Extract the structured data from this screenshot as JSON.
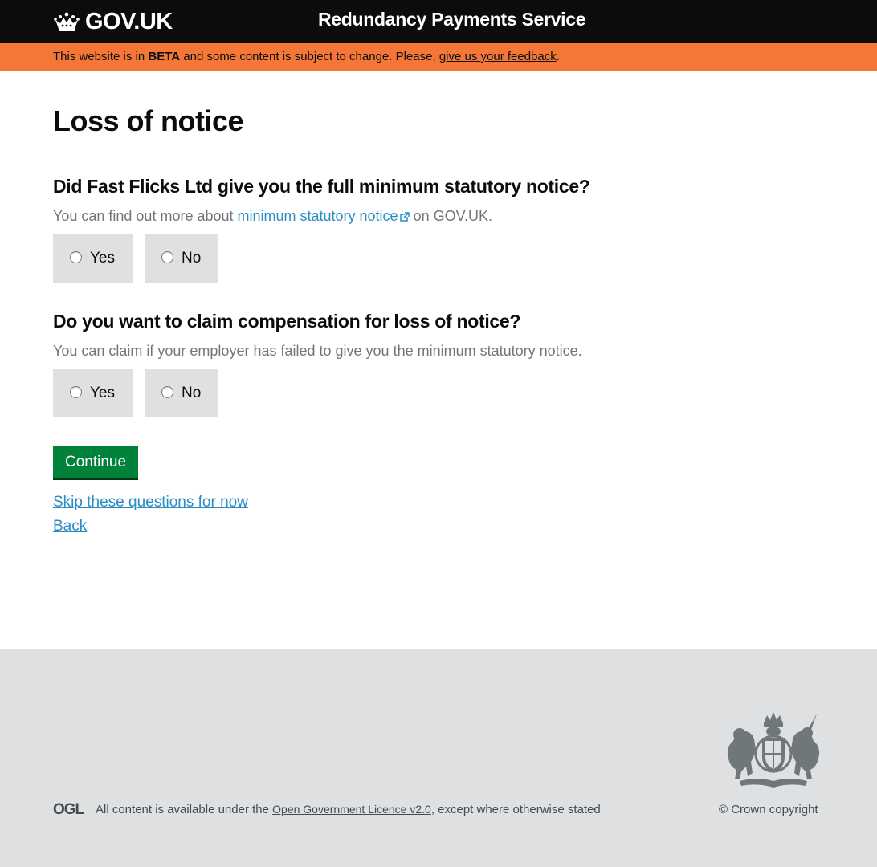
{
  "header": {
    "logo_text": "GOV.UK",
    "service_name": "Redundancy Payments Service"
  },
  "beta_banner": {
    "prefix": "This website is in ",
    "phase": "BETA",
    "middle": " and some content is subject to change. Please, ",
    "feedback_link": "give us your feedback",
    "suffix": "."
  },
  "page_title": "Loss of notice",
  "questions": [
    {
      "label": "Did Fast Flicks Ltd give you the full minimum statutory notice?",
      "hint_prefix": "You can find out more about ",
      "hint_link": "minimum statutory notice",
      "hint_suffix": " on GOV.UK.",
      "options": [
        "Yes",
        "No"
      ]
    },
    {
      "label": "Do you want to claim compensation for loss of notice?",
      "hint": "You can claim if your employer has failed to give you the minimum statutory notice.",
      "options": [
        "Yes",
        "No"
      ]
    }
  ],
  "continue_label": "Continue",
  "skip_link": "Skip these questions for now",
  "back_link": "Back",
  "footer": {
    "ogl_label": "OGL",
    "licence_prefix": "All content is available under the ",
    "licence_link": "Open Government Licence v2.0",
    "licence_suffix": ", except where otherwise stated",
    "copyright": "© Crown copyright"
  },
  "colors": {
    "header_bg": "#0b0c0c",
    "beta_banner_bg": "#f47738",
    "button_green": "#00823b",
    "link_blue": "#2b8cc4",
    "footer_bg": "#dee0e2",
    "radio_bg": "#dee0e2"
  },
  "icons": [
    "crown-icon",
    "external-link-icon",
    "ogl-logo",
    "royal-coat-of-arms"
  ]
}
